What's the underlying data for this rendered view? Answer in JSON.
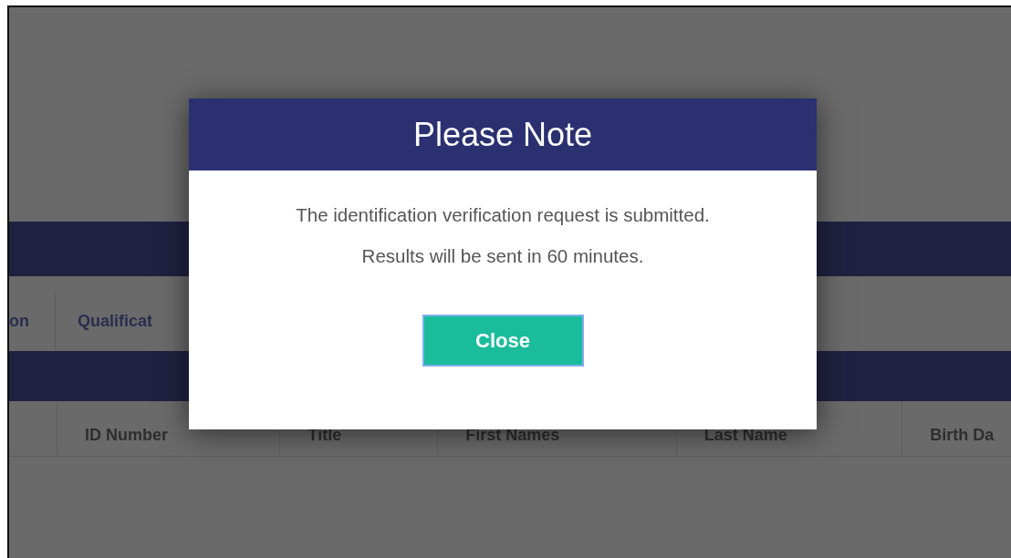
{
  "background": {
    "tabs": [
      {
        "label": "on"
      },
      {
        "label": "Qualificat"
      }
    ],
    "table": {
      "columns": [
        "ID Number",
        "Title",
        "First Names",
        "Last Name",
        "Birth Da"
      ]
    }
  },
  "dialog": {
    "title": "Please Note",
    "message": [
      "The identification verification request is submitted.",
      "Results will be sent in 60 minutes."
    ],
    "buttons": [
      {
        "label": "Close"
      }
    ]
  }
}
